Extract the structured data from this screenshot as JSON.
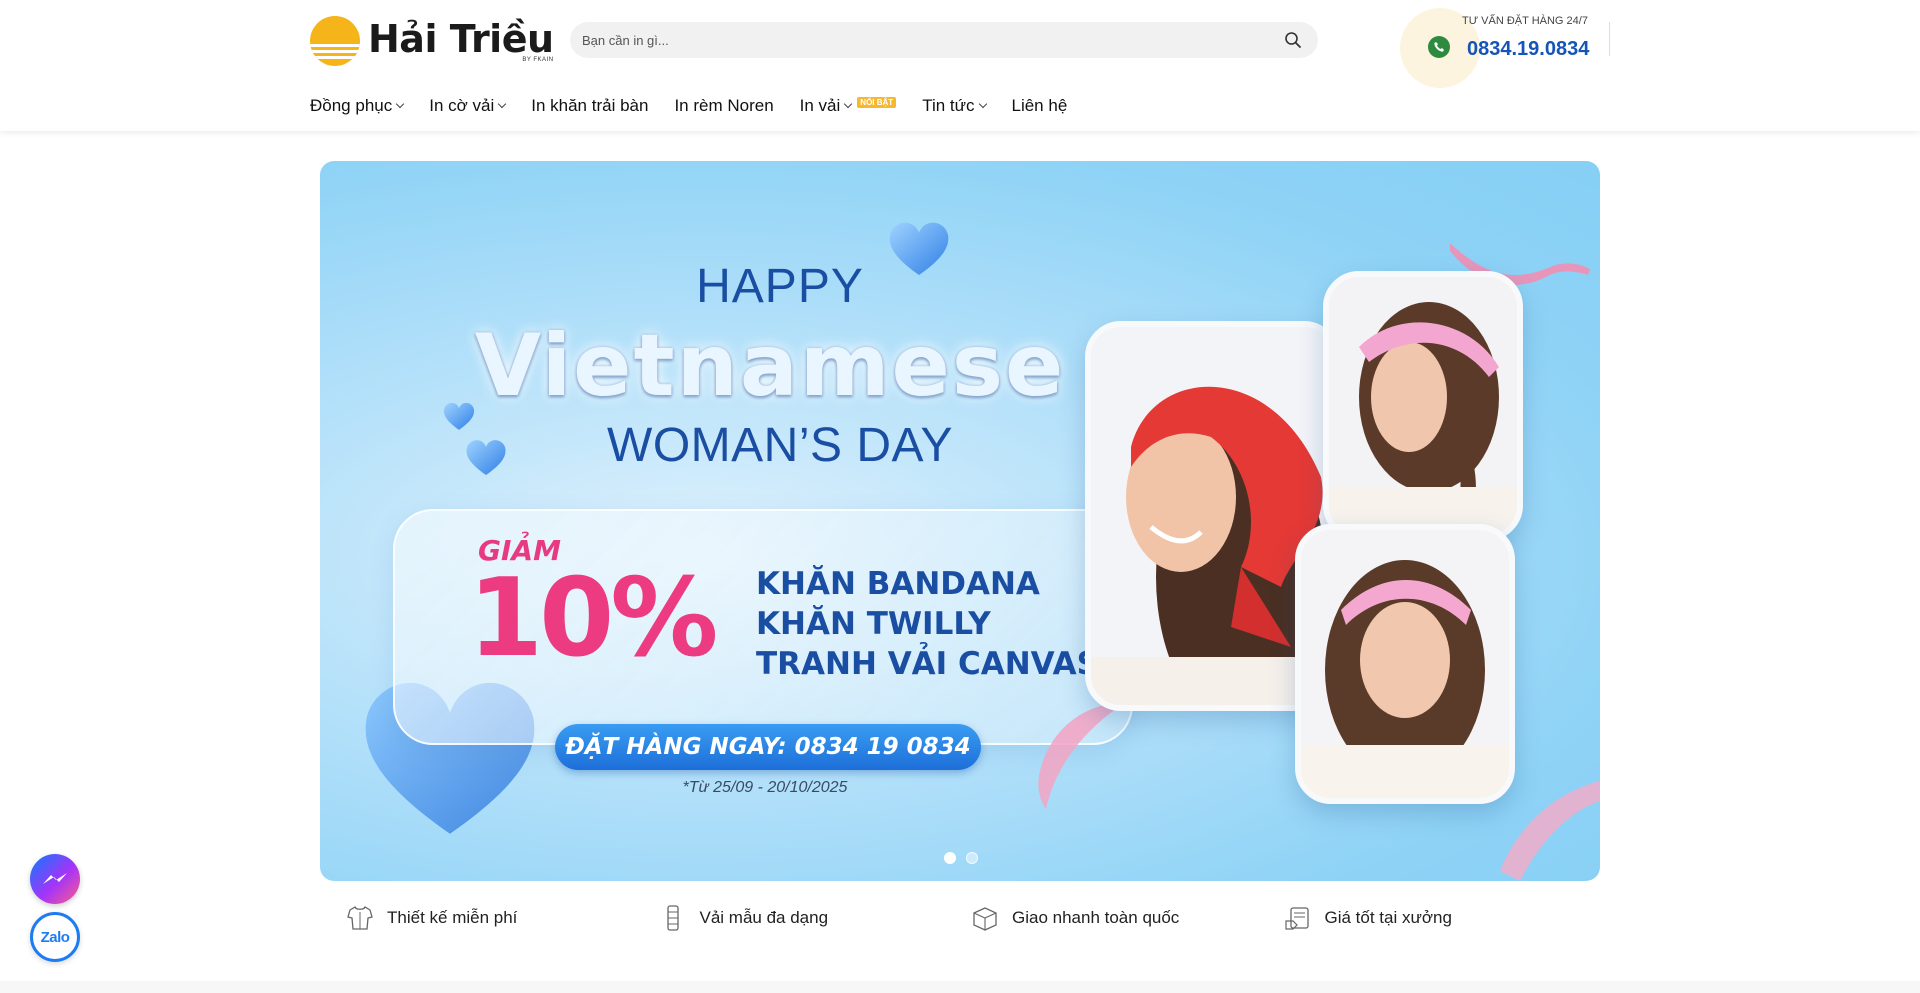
{
  "brand": {
    "name": "Hải Triều",
    "sub": "BY FKAIN",
    "logo_color": "#f4b41a"
  },
  "search": {
    "placeholder": "Bạn cần in gì...",
    "icon": "search-icon"
  },
  "hotline": {
    "caption": "TƯ VẤN ĐẶT HÀNG 24/7",
    "number": "0834.19.0834",
    "icon": "phone-icon",
    "number_color": "#1554b8"
  },
  "nav": {
    "items": [
      {
        "label": "Đồng phục",
        "has_dropdown": true
      },
      {
        "label": "In cờ vải",
        "has_dropdown": true
      },
      {
        "label": "In khăn trải bàn",
        "has_dropdown": false
      },
      {
        "label": "In rèm Noren",
        "has_dropdown": false
      },
      {
        "label": "In vải",
        "has_dropdown": true,
        "badge": "NỔI BẬT"
      },
      {
        "label": "Tin tức",
        "has_dropdown": true
      },
      {
        "label": "Liên hệ",
        "has_dropdown": false
      }
    ]
  },
  "banner": {
    "happy": "HAPPY",
    "vietnamese": "Vietnamese",
    "womans_day": "WOMAN’S DAY",
    "discount_word": "GIẢM",
    "discount_value": "10%",
    "products": [
      "KHĂN BANDANA",
      "KHĂN TWILLY",
      "TRANH VẢI CANVAS"
    ],
    "cta": "ĐẶT HÀNG NGAY: 0834 19 0834",
    "date_note": "*Từ 25/09 - 20/10/2025",
    "slides": 2,
    "active_slide": 1,
    "colors": {
      "blue": "#1a4ea3",
      "pink": "#ec3b80",
      "sky": "#8fd3f6"
    }
  },
  "features": [
    {
      "label": "Thiết kế miễn phí",
      "icon": "shirt-icon"
    },
    {
      "label": "Vải mẫu đa dạng",
      "icon": "fabric-roll-icon"
    },
    {
      "label": "Giao nhanh toàn quốc",
      "icon": "delivery-box-icon"
    },
    {
      "label": "Giá tốt tại xưởng",
      "icon": "price-tag-icon"
    }
  ],
  "floating": {
    "messenger": "messenger-icon",
    "zalo": "Zalo"
  }
}
